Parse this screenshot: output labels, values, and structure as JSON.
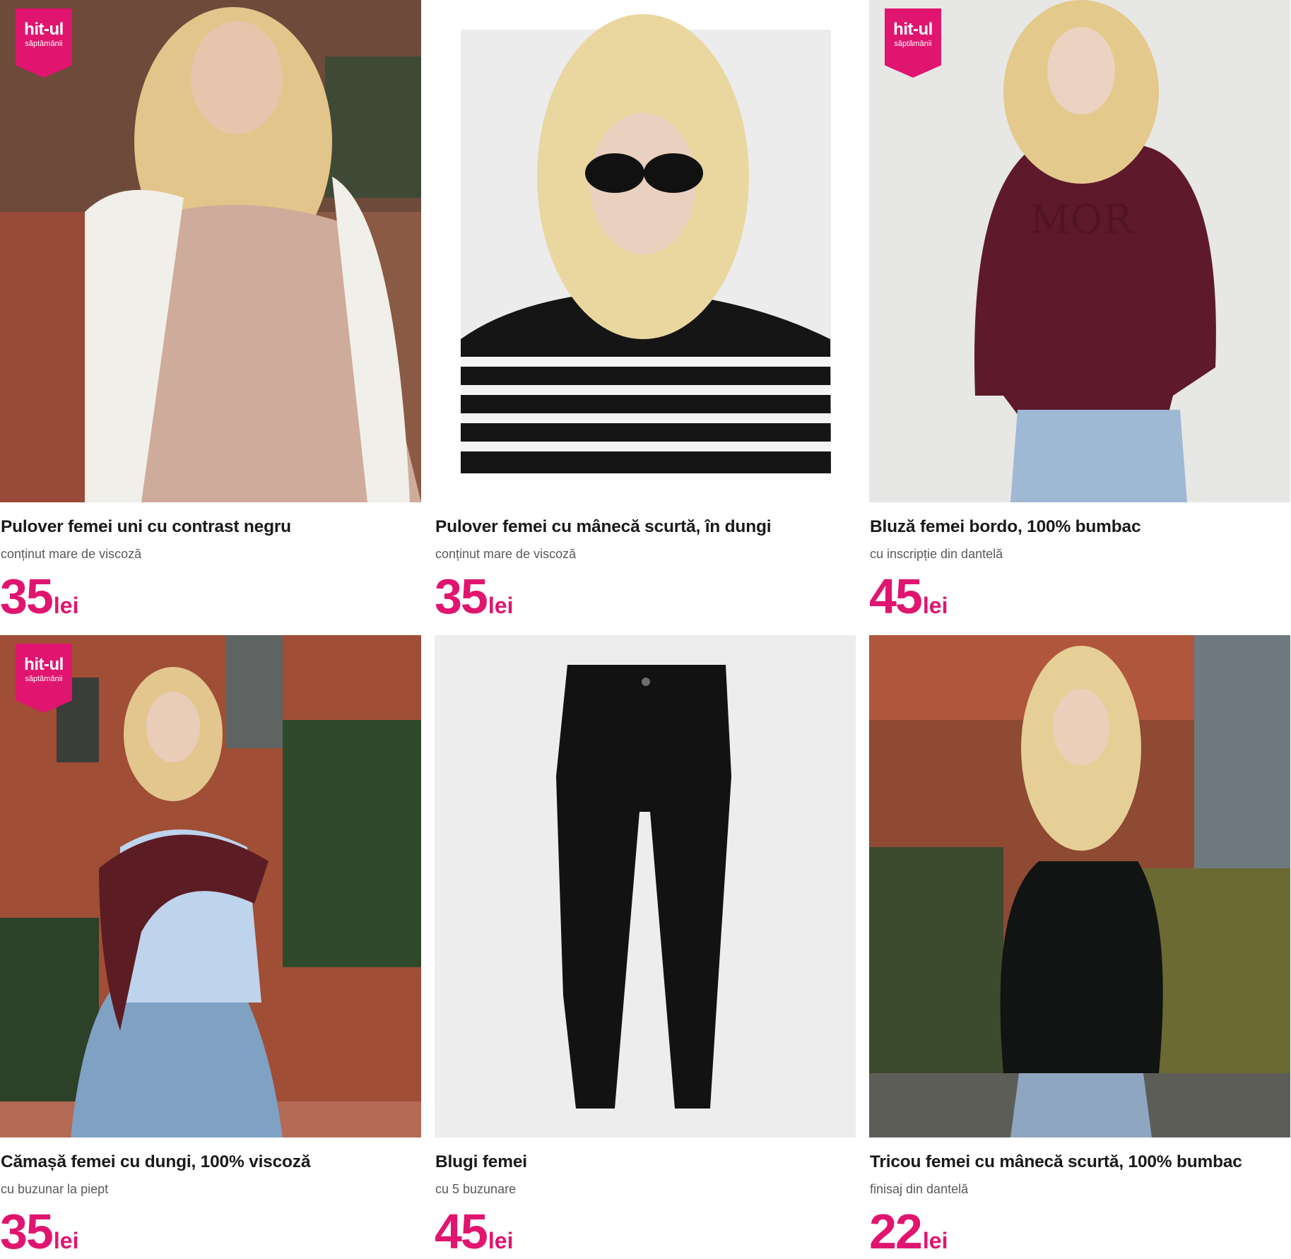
{
  "badge": {
    "line1": "hit-ul",
    "line2": "săptămânii"
  },
  "colors": {
    "accent": "#e0156f",
    "title": "#1a1a1a",
    "subtitle": "#5a5a5a"
  },
  "products": [
    {
      "title": "Pulover femei uni cu contrast negru",
      "subtitle": "conținut mare de viscoză",
      "price": "35",
      "currency": "lei",
      "has_badge": true
    },
    {
      "title": "Pulover femei cu mânecă scurtă, în dungi",
      "subtitle": "conținut mare de viscoză",
      "price": "35",
      "currency": "lei",
      "has_badge": false
    },
    {
      "title": "Bluză femei bordo, 100% bumbac",
      "subtitle": "cu inscripție din dantelă",
      "price": "45",
      "currency": "lei",
      "has_badge": true
    },
    {
      "title": "Cămașă femei cu dungi, 100% viscoză",
      "subtitle": "cu buzunar la piept",
      "price": "35",
      "currency": "lei",
      "has_badge": true
    },
    {
      "title": "Blugi femei",
      "subtitle": "cu 5 buzunare",
      "price": "45",
      "currency": "lei",
      "has_badge": false
    },
    {
      "title": "Tricou femei cu mânecă scurtă, 100% bumbac",
      "subtitle": "finisaj din dantelă",
      "price": "22",
      "currency": "lei",
      "has_badge": false
    }
  ]
}
